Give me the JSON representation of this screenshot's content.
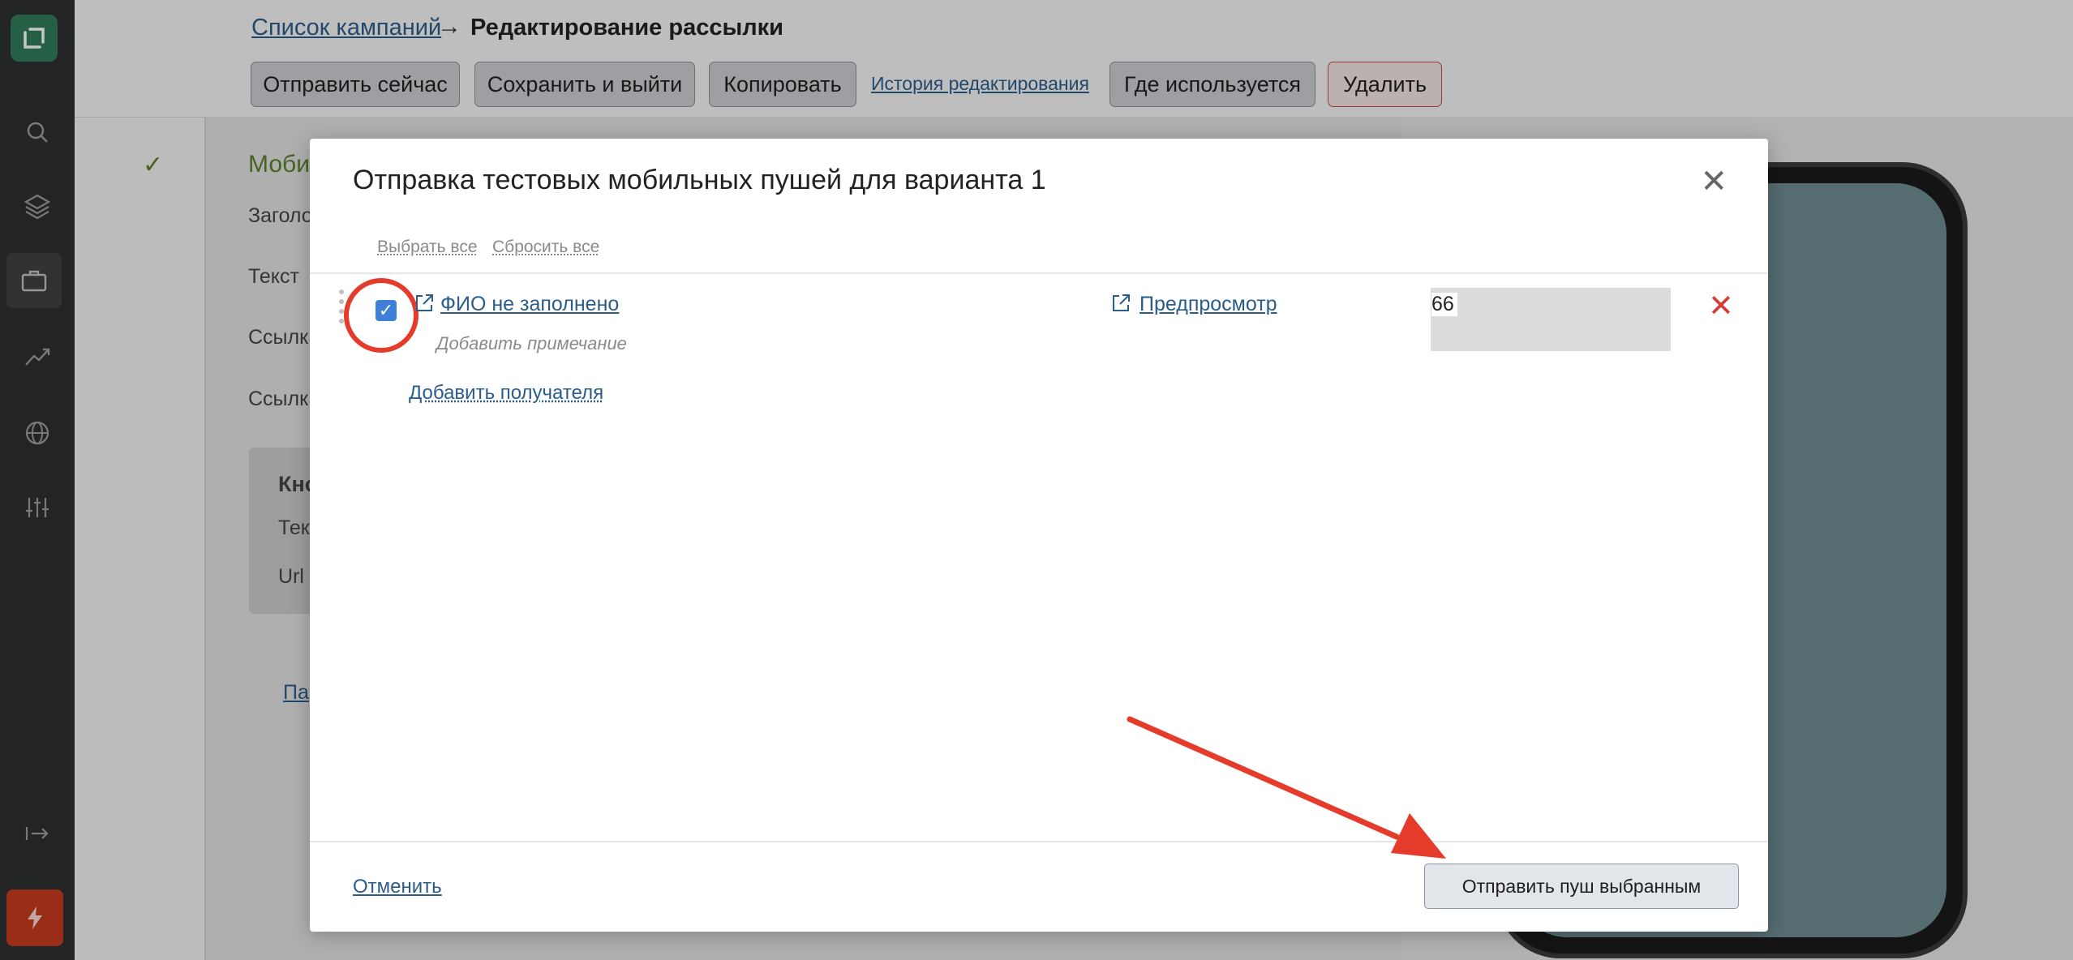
{
  "breadcrumb": {
    "parent": "Список кампаний",
    "separator": "→",
    "current": "Редактирование рассылки"
  },
  "toolbar": {
    "send_now": "Отправить сейчас",
    "save_exit": "Сохранить и выйти",
    "copy": "Копировать",
    "history": "История редактирования",
    "where_used": "Где используется",
    "delete": "Удалить"
  },
  "background_form": {
    "section": "Моби",
    "fields": [
      "Заголо",
      "Текст",
      "Ссылка",
      "Ссылка"
    ],
    "box_title": "Кно",
    "box_fields": [
      "Текс",
      "Url"
    ],
    "link": "Па"
  },
  "modal": {
    "title": "Отправка тестовых мобильных пушей для варианта 1",
    "close": "✕",
    "select_all": "Выбрать все",
    "reset_all": "Сбросить все",
    "recipient": {
      "name": "ФИО не заполнено",
      "note_placeholder": "Добавить примечание",
      "preview": "Предпросмотр",
      "phone": "66",
      "checked": true
    },
    "add_recipient": "Добавить получателя",
    "cancel": "Отменить",
    "send_selected": "Отправить пуш выбранным"
  },
  "colors": {
    "sidebar": "#2d2f31",
    "accent_link": "#2b5c8a",
    "annotation_red": "#e53b2b",
    "checkbox": "#3e7fd9"
  },
  "icons": {
    "check": "✓",
    "delete_row": "✕"
  }
}
